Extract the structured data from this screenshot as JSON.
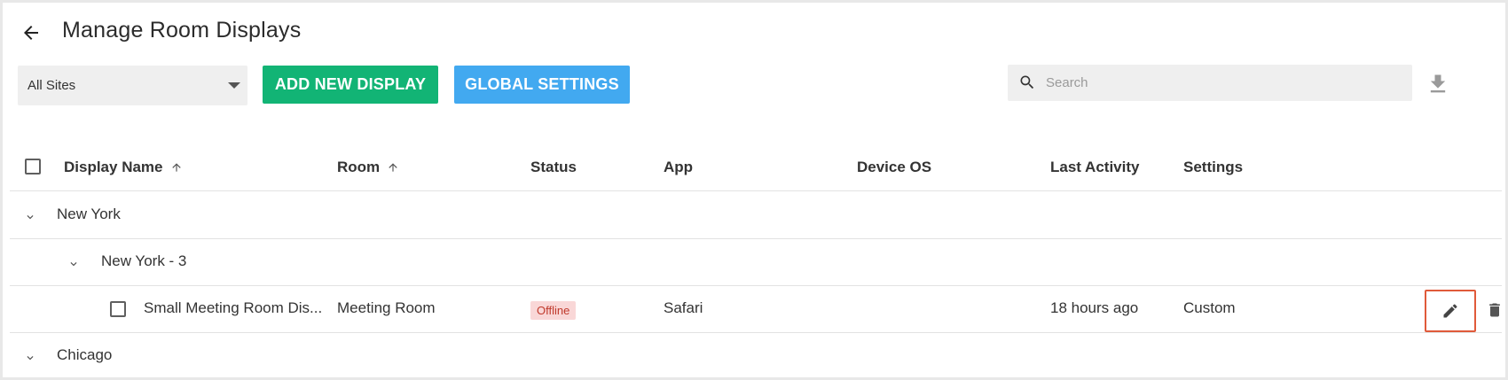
{
  "header": {
    "title": "Manage Room Displays"
  },
  "toolbar": {
    "site_filter_value": "All Sites",
    "add_button_label": "ADD NEW DISPLAY",
    "global_settings_label": "GLOBAL SETTINGS",
    "search_placeholder": "Search"
  },
  "table": {
    "columns": {
      "display_name": "Display Name",
      "room": "Room",
      "status": "Status",
      "app": "App",
      "device_os": "Device OS",
      "last_activity": "Last Activity",
      "settings": "Settings"
    },
    "groups": [
      {
        "label": "New York"
      },
      {
        "label": "New York - 3"
      },
      {
        "label": "Chicago"
      }
    ],
    "rows": [
      {
        "display_name": "Small Meeting Room Dis...",
        "room": "Meeting Room",
        "status": "Offline",
        "app": "Safari",
        "device_os": "",
        "last_activity": "18 hours ago",
        "settings": "Custom"
      }
    ]
  },
  "colors": {
    "add_button": "#12b475",
    "global_settings_button": "#42a9f0",
    "status_offline_bg": "#f9d7d7",
    "status_offline_text": "#c0392b",
    "highlight_border": "#e05a3a"
  },
  "icons": {
    "back": "arrow-left-icon",
    "dropdown": "caret-down-icon",
    "search": "search-icon",
    "download": "download-icon",
    "sort": "arrow-up-icon",
    "expand": "chevron-down-icon",
    "edit": "pencil-icon",
    "delete": "trash-icon"
  }
}
